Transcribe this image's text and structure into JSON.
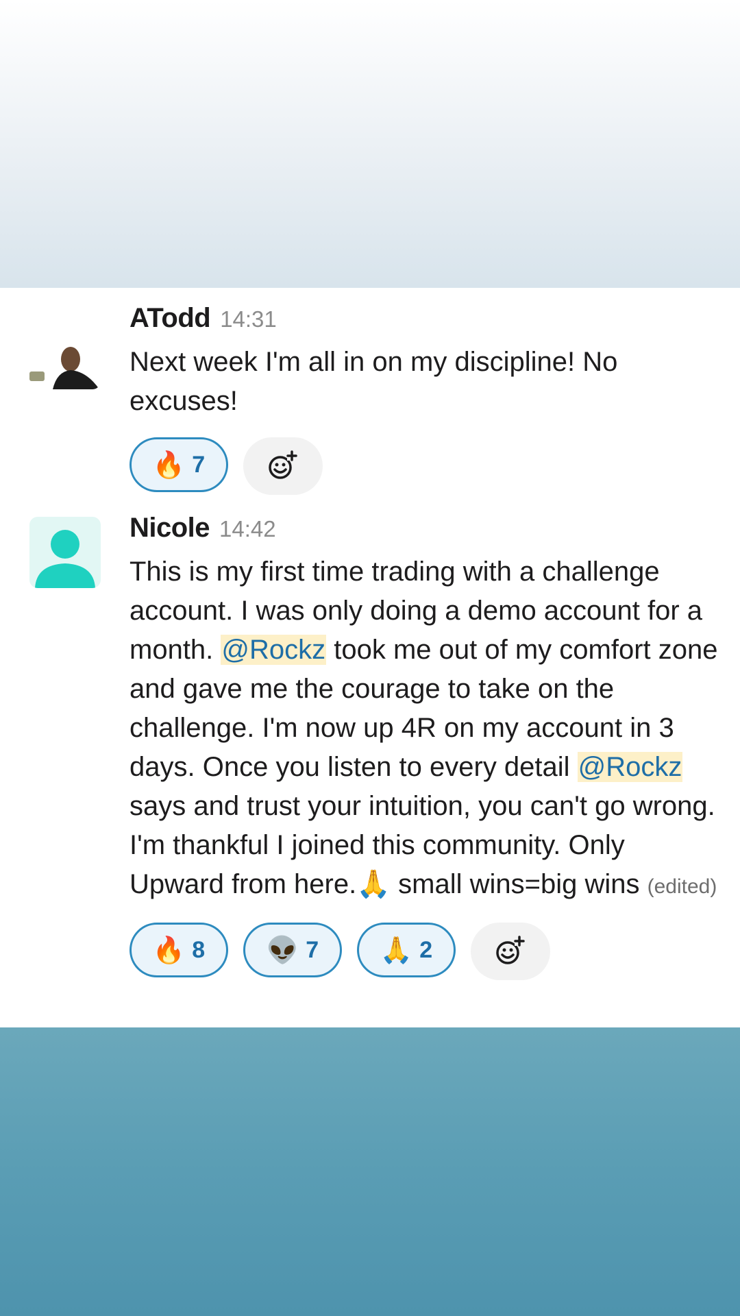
{
  "messages": [
    {
      "author": "ATodd",
      "time": "14:31",
      "text": "Next week I'm all in on my discipline! No excuses!",
      "reactions": [
        {
          "emoji": "🔥",
          "icon": "fire-emoji",
          "count": "7"
        }
      ]
    },
    {
      "author": "Nicole",
      "time": "14:42",
      "text_parts": [
        "This is my first time trading with a challenge account. I was only doing a demo account for a month. ",
        "@Rockz",
        " took me out of my comfort zone and gave me the courage to take on the challenge. I'm now up 4R on my account in 3 days. Once you listen to every detail ",
        "@Rockz",
        " says  and trust your intuition, you can't go wrong. I'm thankful I joined this community. Only Upward from here.",
        "🙏",
        " small wins=big wins "
      ],
      "edited_label": "(edited)",
      "reactions": [
        {
          "emoji": "🔥",
          "icon": "fire-emoji",
          "count": "8"
        },
        {
          "emoji": "👽",
          "icon": "alien-emoji",
          "count": "7"
        },
        {
          "emoji": "🙏",
          "icon": "folded-hands-emoji",
          "count": "2"
        }
      ]
    }
  ],
  "colors": {
    "mention_bg": "#fdf0c8",
    "mention_text": "#1e6ea7",
    "reaction_border": "#2d8bbf",
    "reaction_bg": "#eaf4fb"
  }
}
